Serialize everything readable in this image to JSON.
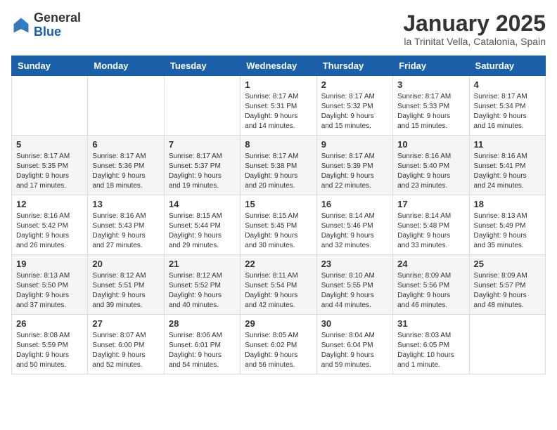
{
  "header": {
    "logo_general": "General",
    "logo_blue": "Blue",
    "month_title": "January 2025",
    "location": "la Trinitat Vella, Catalonia, Spain"
  },
  "weekdays": [
    "Sunday",
    "Monday",
    "Tuesday",
    "Wednesday",
    "Thursday",
    "Friday",
    "Saturday"
  ],
  "weeks": [
    [
      {
        "day": "",
        "info": ""
      },
      {
        "day": "",
        "info": ""
      },
      {
        "day": "",
        "info": ""
      },
      {
        "day": "1",
        "info": "Sunrise: 8:17 AM\nSunset: 5:31 PM\nDaylight: 9 hours\nand 14 minutes."
      },
      {
        "day": "2",
        "info": "Sunrise: 8:17 AM\nSunset: 5:32 PM\nDaylight: 9 hours\nand 15 minutes."
      },
      {
        "day": "3",
        "info": "Sunrise: 8:17 AM\nSunset: 5:33 PM\nDaylight: 9 hours\nand 15 minutes."
      },
      {
        "day": "4",
        "info": "Sunrise: 8:17 AM\nSunset: 5:34 PM\nDaylight: 9 hours\nand 16 minutes."
      }
    ],
    [
      {
        "day": "5",
        "info": "Sunrise: 8:17 AM\nSunset: 5:35 PM\nDaylight: 9 hours\nand 17 minutes."
      },
      {
        "day": "6",
        "info": "Sunrise: 8:17 AM\nSunset: 5:36 PM\nDaylight: 9 hours\nand 18 minutes."
      },
      {
        "day": "7",
        "info": "Sunrise: 8:17 AM\nSunset: 5:37 PM\nDaylight: 9 hours\nand 19 minutes."
      },
      {
        "day": "8",
        "info": "Sunrise: 8:17 AM\nSunset: 5:38 PM\nDaylight: 9 hours\nand 20 minutes."
      },
      {
        "day": "9",
        "info": "Sunrise: 8:17 AM\nSunset: 5:39 PM\nDaylight: 9 hours\nand 22 minutes."
      },
      {
        "day": "10",
        "info": "Sunrise: 8:16 AM\nSunset: 5:40 PM\nDaylight: 9 hours\nand 23 minutes."
      },
      {
        "day": "11",
        "info": "Sunrise: 8:16 AM\nSunset: 5:41 PM\nDaylight: 9 hours\nand 24 minutes."
      }
    ],
    [
      {
        "day": "12",
        "info": "Sunrise: 8:16 AM\nSunset: 5:42 PM\nDaylight: 9 hours\nand 26 minutes."
      },
      {
        "day": "13",
        "info": "Sunrise: 8:16 AM\nSunset: 5:43 PM\nDaylight: 9 hours\nand 27 minutes."
      },
      {
        "day": "14",
        "info": "Sunrise: 8:15 AM\nSunset: 5:44 PM\nDaylight: 9 hours\nand 29 minutes."
      },
      {
        "day": "15",
        "info": "Sunrise: 8:15 AM\nSunset: 5:45 PM\nDaylight: 9 hours\nand 30 minutes."
      },
      {
        "day": "16",
        "info": "Sunrise: 8:14 AM\nSunset: 5:46 PM\nDaylight: 9 hours\nand 32 minutes."
      },
      {
        "day": "17",
        "info": "Sunrise: 8:14 AM\nSunset: 5:48 PM\nDaylight: 9 hours\nand 33 minutes."
      },
      {
        "day": "18",
        "info": "Sunrise: 8:13 AM\nSunset: 5:49 PM\nDaylight: 9 hours\nand 35 minutes."
      }
    ],
    [
      {
        "day": "19",
        "info": "Sunrise: 8:13 AM\nSunset: 5:50 PM\nDaylight: 9 hours\nand 37 minutes."
      },
      {
        "day": "20",
        "info": "Sunrise: 8:12 AM\nSunset: 5:51 PM\nDaylight: 9 hours\nand 39 minutes."
      },
      {
        "day": "21",
        "info": "Sunrise: 8:12 AM\nSunset: 5:52 PM\nDaylight: 9 hours\nand 40 minutes."
      },
      {
        "day": "22",
        "info": "Sunrise: 8:11 AM\nSunset: 5:54 PM\nDaylight: 9 hours\nand 42 minutes."
      },
      {
        "day": "23",
        "info": "Sunrise: 8:10 AM\nSunset: 5:55 PM\nDaylight: 9 hours\nand 44 minutes."
      },
      {
        "day": "24",
        "info": "Sunrise: 8:09 AM\nSunset: 5:56 PM\nDaylight: 9 hours\nand 46 minutes."
      },
      {
        "day": "25",
        "info": "Sunrise: 8:09 AM\nSunset: 5:57 PM\nDaylight: 9 hours\nand 48 minutes."
      }
    ],
    [
      {
        "day": "26",
        "info": "Sunrise: 8:08 AM\nSunset: 5:59 PM\nDaylight: 9 hours\nand 50 minutes."
      },
      {
        "day": "27",
        "info": "Sunrise: 8:07 AM\nSunset: 6:00 PM\nDaylight: 9 hours\nand 52 minutes."
      },
      {
        "day": "28",
        "info": "Sunrise: 8:06 AM\nSunset: 6:01 PM\nDaylight: 9 hours\nand 54 minutes."
      },
      {
        "day": "29",
        "info": "Sunrise: 8:05 AM\nSunset: 6:02 PM\nDaylight: 9 hours\nand 56 minutes."
      },
      {
        "day": "30",
        "info": "Sunrise: 8:04 AM\nSunset: 6:04 PM\nDaylight: 9 hours\nand 59 minutes."
      },
      {
        "day": "31",
        "info": "Sunrise: 8:03 AM\nSunset: 6:05 PM\nDaylight: 10 hours\nand 1 minute."
      },
      {
        "day": "",
        "info": ""
      }
    ]
  ]
}
